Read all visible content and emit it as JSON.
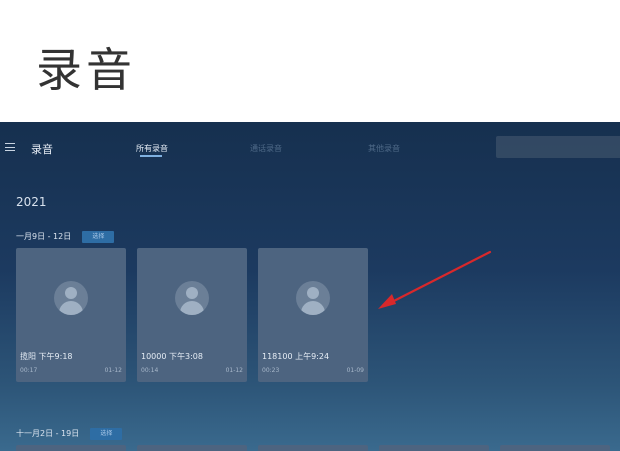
{
  "page_heading": "录音",
  "app": {
    "title": "录音",
    "tabs": [
      {
        "label": "所有录音",
        "active": true
      },
      {
        "label": "通话录音",
        "active": false
      },
      {
        "label": "其他录音",
        "active": false
      }
    ]
  },
  "year": "2021",
  "groups": [
    {
      "date_range": "一月9日 - 12日",
      "select_label": "选择",
      "cards": [
        {
          "name": "揽阳 下午9:18",
          "duration": "00:17",
          "date": "01-12"
        },
        {
          "name": "10000 下午3:08",
          "duration": "00:14",
          "date": "01-12"
        },
        {
          "name": "118100 上午9:24",
          "duration": "00:23",
          "date": "01-09"
        }
      ]
    },
    {
      "date_range": "十一月2日 - 19日",
      "select_label": "选择"
    }
  ],
  "colors": {
    "accent": "#2e6da4",
    "annotation_arrow": "#d8282b"
  }
}
